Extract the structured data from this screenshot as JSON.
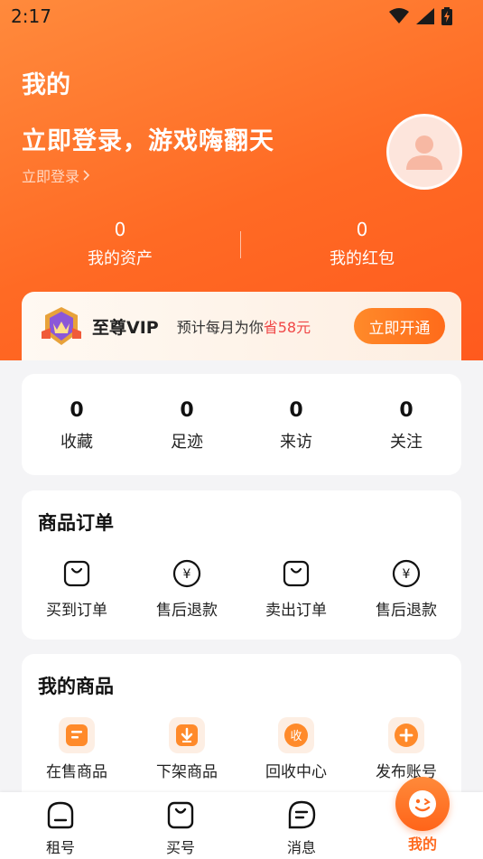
{
  "status_bar": {
    "time": "2:17",
    "icons": [
      "wifi-icon",
      "signal-icon",
      "battery-charging-icon"
    ]
  },
  "header": {
    "title": "我的",
    "login_title": "立即登录，游戏嗨翻天",
    "login_link": "立即登录",
    "avatar_icon": "user-avatar-icon"
  },
  "stats": [
    {
      "value": "0",
      "label": "我的资产"
    },
    {
      "value": "0",
      "label": "我的红包"
    }
  ],
  "vip": {
    "name": "至尊VIP",
    "desc": "预计每月为你",
    "save": "省58元",
    "button": "立即开通",
    "badge_icon": "vip-crown-badge-icon"
  },
  "counts": [
    {
      "value": "0",
      "label": "收藏"
    },
    {
      "value": "0",
      "label": "足迹"
    },
    {
      "value": "0",
      "label": "来访"
    },
    {
      "value": "0",
      "label": "关注"
    }
  ],
  "orders": {
    "title": "商品订单",
    "items": [
      {
        "label": "买到订单",
        "icon": "shopping-bag-icon"
      },
      {
        "label": "售后退款",
        "icon": "yen-refund-icon"
      },
      {
        "label": "卖出订单",
        "icon": "shopping-bag-icon"
      },
      {
        "label": "售后退款",
        "icon": "yen-refund-icon"
      }
    ]
  },
  "goods": {
    "title": "我的商品",
    "items": [
      {
        "label": "在售商品",
        "icon": "on-sale-icon"
      },
      {
        "label": "下架商品",
        "icon": "delist-icon"
      },
      {
        "label": "回收中心",
        "icon": "recycle-icon",
        "glyph": "收"
      },
      {
        "label": "发布账号",
        "icon": "publish-add-icon"
      }
    ]
  },
  "tabbar": {
    "items": [
      {
        "label": "租号",
        "icon": "rent-home-icon"
      },
      {
        "label": "买号",
        "icon": "buy-bag-icon"
      },
      {
        "label": "消息",
        "icon": "message-icon"
      },
      {
        "label": "我的",
        "icon": "mine-face-icon",
        "active": true
      }
    ]
  },
  "colors": {
    "brand": "#ff6a1f",
    "highlight": "#f04646"
  }
}
